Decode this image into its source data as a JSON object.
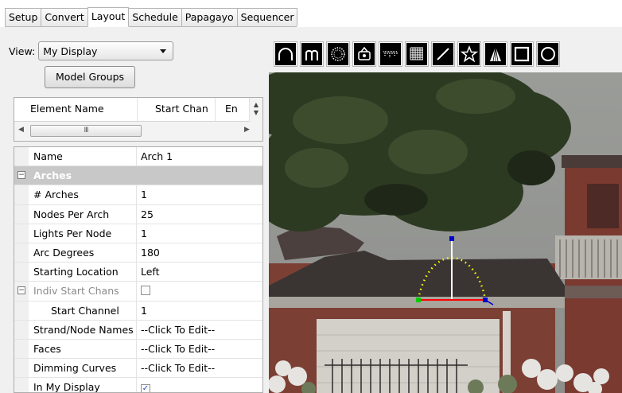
{
  "tabs": [
    {
      "label": "Setup",
      "active": false
    },
    {
      "label": "Convert",
      "active": false
    },
    {
      "label": "Layout",
      "active": true
    },
    {
      "label": "Schedule",
      "active": false
    },
    {
      "label": "Papagayo",
      "active": false
    },
    {
      "label": "Sequencer",
      "active": false
    }
  ],
  "view": {
    "label": "View:",
    "selected": "My Display"
  },
  "model_groups_button": "Model Groups",
  "element_list": {
    "columns": [
      "Element Name",
      "Start Chan",
      "En"
    ],
    "hscroll_thumb": "III"
  },
  "properties": [
    {
      "type": "prop",
      "name": "Name",
      "value": "Arch 1"
    },
    {
      "type": "category",
      "name": "Arches"
    },
    {
      "type": "prop",
      "name": "# Arches",
      "value": "1"
    },
    {
      "type": "prop",
      "name": "Nodes Per Arch",
      "value": "25"
    },
    {
      "type": "prop",
      "name": "Lights Per Node",
      "value": "1"
    },
    {
      "type": "prop",
      "name": "Arc Degrees",
      "value": "180"
    },
    {
      "type": "prop",
      "name": "Starting Location",
      "value": "Left"
    },
    {
      "type": "checkbox",
      "name": "Indiv Start Chans",
      "checked": false,
      "disabled": true,
      "collapsible": true
    },
    {
      "type": "prop",
      "name": "Start Channel",
      "value": "1",
      "indent": true
    },
    {
      "type": "prop",
      "name": "Strand/Node Names",
      "value": "--Click To Edit--"
    },
    {
      "type": "prop",
      "name": "Faces",
      "value": "--Click To Edit--"
    },
    {
      "type": "prop",
      "name": "Dimming Curves",
      "value": "--Click To Edit--"
    },
    {
      "type": "checkbox",
      "name": "In My Display",
      "checked": true
    }
  ],
  "toolbar_icons": [
    "arch-icon",
    "candy-cane-icon",
    "circle-dots-icon",
    "custom-model-icon",
    "icicles-icon",
    "matrix-icon",
    "single-line-icon",
    "star-icon",
    "tree-icon",
    "window-frame-icon",
    "circle-icon"
  ],
  "colors": {
    "panel_bg": "#f0f0f0",
    "category_bg": "#c8c8c8",
    "arch_dots": "#ffff00",
    "handle_blue": "#0000cc",
    "handle_green": "#00cc00",
    "base_line_red": "#ff0000"
  }
}
